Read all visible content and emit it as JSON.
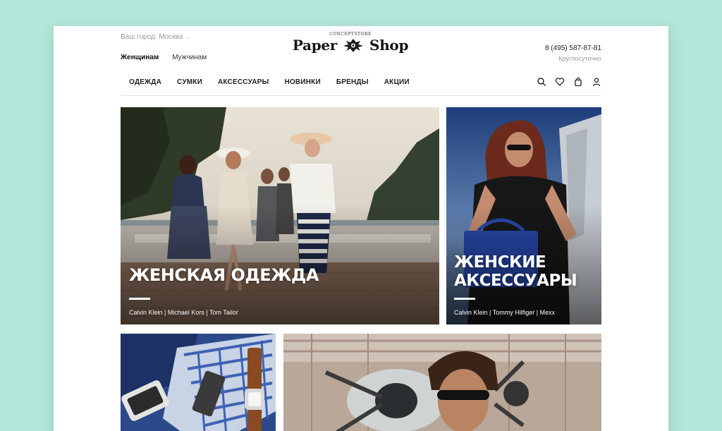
{
  "header": {
    "city": "Ваш город: Москва",
    "gender_tabs": [
      "Женщинам",
      "Мужчинам"
    ],
    "logo_top": "CONCEPTSTORE",
    "logo_left": "Paper",
    "logo_right": "Shop",
    "phone": "8 (495) 587-87-81",
    "hours": "Круглосуточно"
  },
  "nav": {
    "items": [
      "ОДЕЖДА",
      "СУМКИ",
      "АКСЕССУАРЫ",
      "НОВИНКИ",
      "БРЕНДЫ",
      "АКЦИИ"
    ],
    "icons": [
      "search-icon",
      "heart-icon",
      "bag-icon",
      "user-icon"
    ]
  },
  "tiles": [
    {
      "title": "ЖЕНСКАЯ ОДЕЖДА",
      "brands": "Calvin Klein | Michael Kors | Tom Tailor"
    },
    {
      "title_line1": "ЖЕНСКИЕ",
      "title_line2": "АКСЕССУАРЫ",
      "brands": "Calvin Klein | Tommy Hilfiger | Mexx"
    }
  ],
  "colors": {
    "background": "#b5e6da",
    "page": "#ffffff",
    "text": "#222222",
    "muted": "#9a9a9a"
  }
}
